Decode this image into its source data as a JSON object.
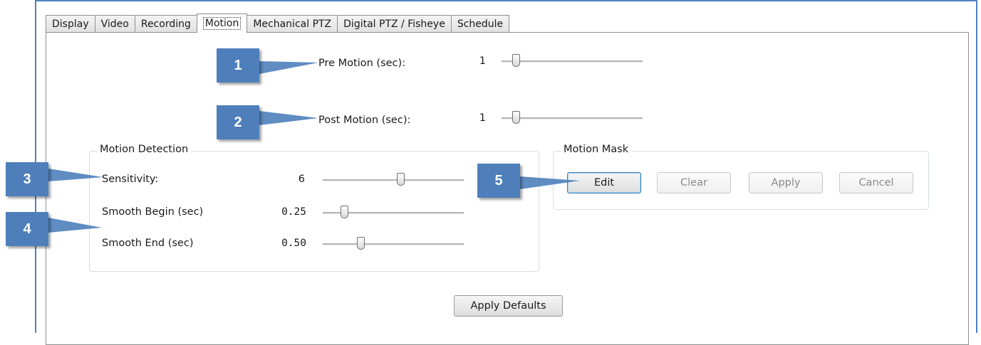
{
  "tabs": [
    {
      "label": "Display"
    },
    {
      "label": "Video"
    },
    {
      "label": "Recording"
    },
    {
      "label": "Motion"
    },
    {
      "label": "Mechanical PTZ"
    },
    {
      "label": "Digital PTZ / Fisheye"
    },
    {
      "label": "Schedule"
    }
  ],
  "active_tab": "Motion",
  "pre_motion": {
    "label": "Pre Motion (sec):",
    "value": "1",
    "level": 0.1
  },
  "post_motion": {
    "label": "Post Motion (sec):",
    "value": "1",
    "level": 0.1
  },
  "motion_detection": {
    "title": "Motion Detection",
    "sensitivity": {
      "label": "Sensitivity:",
      "value": "6",
      "level": 0.55
    },
    "smooth_begin": {
      "label": "Smooth Begin (sec)",
      "value": "0.25",
      "level": 0.15
    },
    "smooth_end": {
      "label": "Smooth End (sec)",
      "value": "0.50",
      "level": 0.27
    }
  },
  "motion_mask": {
    "title": "Motion Mask",
    "edit": "Edit",
    "clear": "Clear",
    "apply": "Apply",
    "cancel": "Cancel"
  },
  "apply_defaults": "Apply Defaults",
  "callouts": [
    "1",
    "2",
    "3",
    "4",
    "5"
  ],
  "colors": {
    "callout": "#4e7fba",
    "frame": "#4f81bd"
  }
}
